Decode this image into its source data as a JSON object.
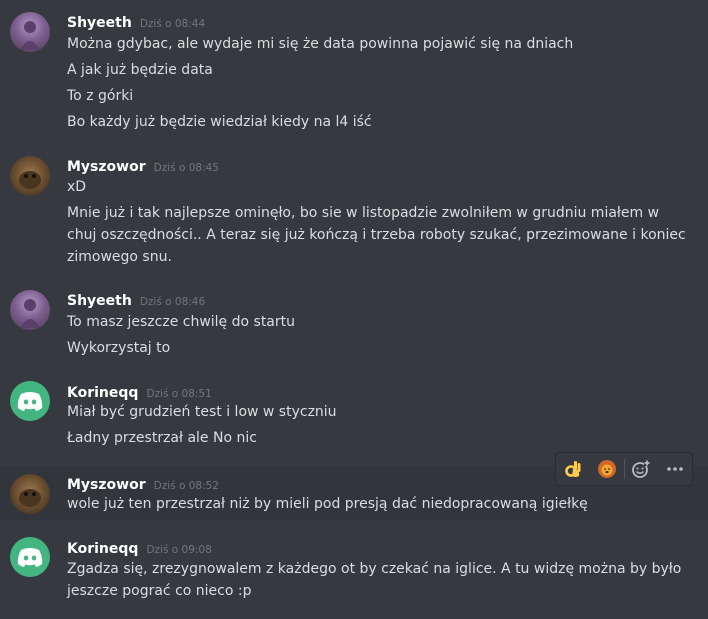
{
  "messages": [
    {
      "author": "Shyeeth",
      "time": "Dziś o 08:44",
      "lines": [
        "Można gdybac, ale wydaje mi się że data powinna pojawić się na dniach",
        "A jak już będzie data",
        "To z górki",
        "Bo każdy już będzie wiedział kiedy na l4 iść"
      ]
    },
    {
      "author": "Myszowor",
      "time": "Dziś o 08:45",
      "lines": [
        "xD",
        "Mnie już i tak najlepsze ominęło, bo sie w listopadzie zwolniłem w grudniu miałem w chuj oszczędności.. A teraz się już kończą i trzeba roboty szukać, przezimowane i koniec zimowego snu."
      ]
    },
    {
      "author": "Shyeeth",
      "time": "Dziś o 08:46",
      "lines": [
        "To masz jeszcze chwilę do startu",
        "Wykorzystaj to"
      ]
    },
    {
      "author": "Korineqq",
      "time": "Dziś o 08:51",
      "lines": [
        "Miał być grudzień test i low w styczniu",
        "Ładny przestrzał ale No nic"
      ]
    },
    {
      "author": "Myszowor",
      "time": "Dziś o 08:52",
      "lines": [
        "wole już ten przestrzał niż by mieli pod presją dać niedopracowaną igiełkę"
      ]
    },
    {
      "author": "Korineqq",
      "time": "Dziś o 09:08",
      "lines": [
        "Zgadza się, zrezygnowalem z każdego ot by czekać na iglice. A tu widzę można by było jeszcze pograć co nieco :p"
      ]
    }
  ],
  "toolbar": {
    "icons": [
      "ok-hand-emoji",
      "lion-emoji",
      "add-reaction-icon",
      "more-icon"
    ]
  },
  "colors": {
    "background": "#36393f",
    "hover_background": "#32353b",
    "username": "#ffffff",
    "text": "#dcddde",
    "timestamp": "#72767d",
    "discord_avatar": "#43b581"
  }
}
